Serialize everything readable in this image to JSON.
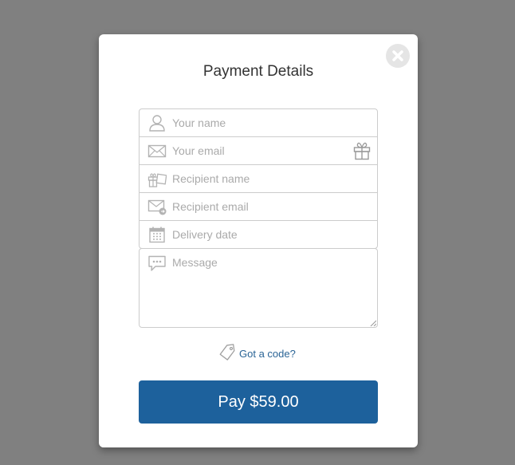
{
  "modal": {
    "title": "Payment Details",
    "close_icon": "close-circle-icon"
  },
  "fields": {
    "your_name": {
      "placeholder": "Your name",
      "value": "",
      "icon": "user-icon"
    },
    "your_email": {
      "placeholder": "Your email",
      "value": "",
      "icon": "envelope-icon",
      "action_icon": "gift-icon"
    },
    "recipient_name": {
      "placeholder": "Recipient name",
      "value": "",
      "icon": "gift-card-icon"
    },
    "recipient_email": {
      "placeholder": "Recipient email",
      "value": "",
      "icon": "envelope-send-icon"
    },
    "delivery_date": {
      "placeholder": "Delivery date",
      "value": "",
      "icon": "calendar-icon"
    },
    "message": {
      "placeholder": "Message",
      "value": "",
      "icon": "speech-bubble-icon"
    }
  },
  "promo": {
    "label": "Got a code?",
    "icon": "tag-icon"
  },
  "pay_button": {
    "label": "Pay $59.00"
  },
  "colors": {
    "overlay": "#808080",
    "accent": "#1d619c",
    "link": "#2a6496",
    "icon": "#b3b3b3"
  }
}
